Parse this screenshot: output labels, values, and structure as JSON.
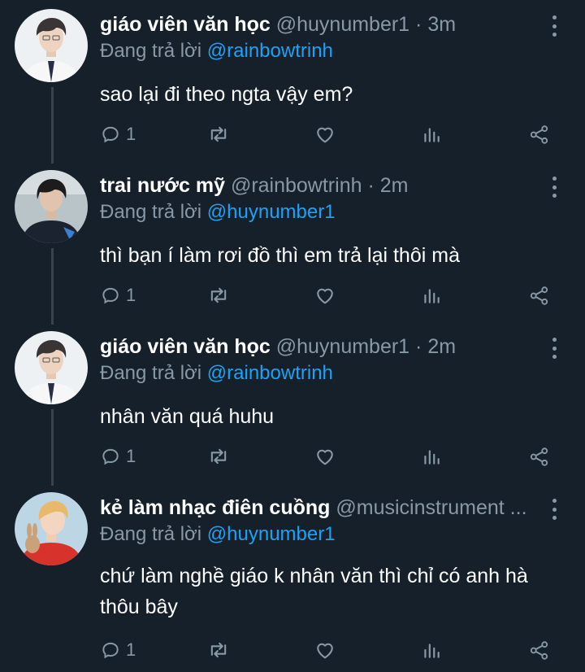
{
  "colors": {
    "background": "#15202b",
    "secondary_text": "#8899a6",
    "link": "#1da1f2",
    "thread_line": "#38444d"
  },
  "reply_prefix": "Đang trả lời",
  "tweets": [
    {
      "name": "giáo viên văn học",
      "handle": "@huynumber1",
      "time": "· 3m",
      "reply_to": "@rainbowtrinh",
      "text": "sao lại đi theo ngta vậy em?",
      "reply_count": "1",
      "avatar": "avatar-white-shirt"
    },
    {
      "name": "trai nước mỹ",
      "handle": "@rainbowtrinh",
      "time": "· 2m",
      "reply_to": "@huynumber1",
      "text": "thì bạn í làm rơi đồ thì em trả lại thôi mà",
      "reply_count": "1",
      "avatar": "avatar-dark-jacket"
    },
    {
      "name": "giáo viên văn học",
      "handle": "@huynumber1",
      "time": "· 2m",
      "reply_to": "@rainbowtrinh",
      "text": "nhân văn quá huhu",
      "reply_count": "1",
      "avatar": "avatar-white-shirt"
    },
    {
      "name": "kẻ làm nhạc điên cuồng",
      "handle": "@musicinstrument ...",
      "time": "",
      "reply_to": "@huynumber1",
      "text": "chứ làm nghề giáo k nhân văn thì chỉ có anh hà thôu bây",
      "reply_count": "1",
      "avatar": "avatar-red-sweater-bunny"
    }
  ],
  "action_icons": [
    "reply-icon",
    "retweet-icon",
    "like-icon",
    "analytics-icon",
    "share-icon"
  ]
}
